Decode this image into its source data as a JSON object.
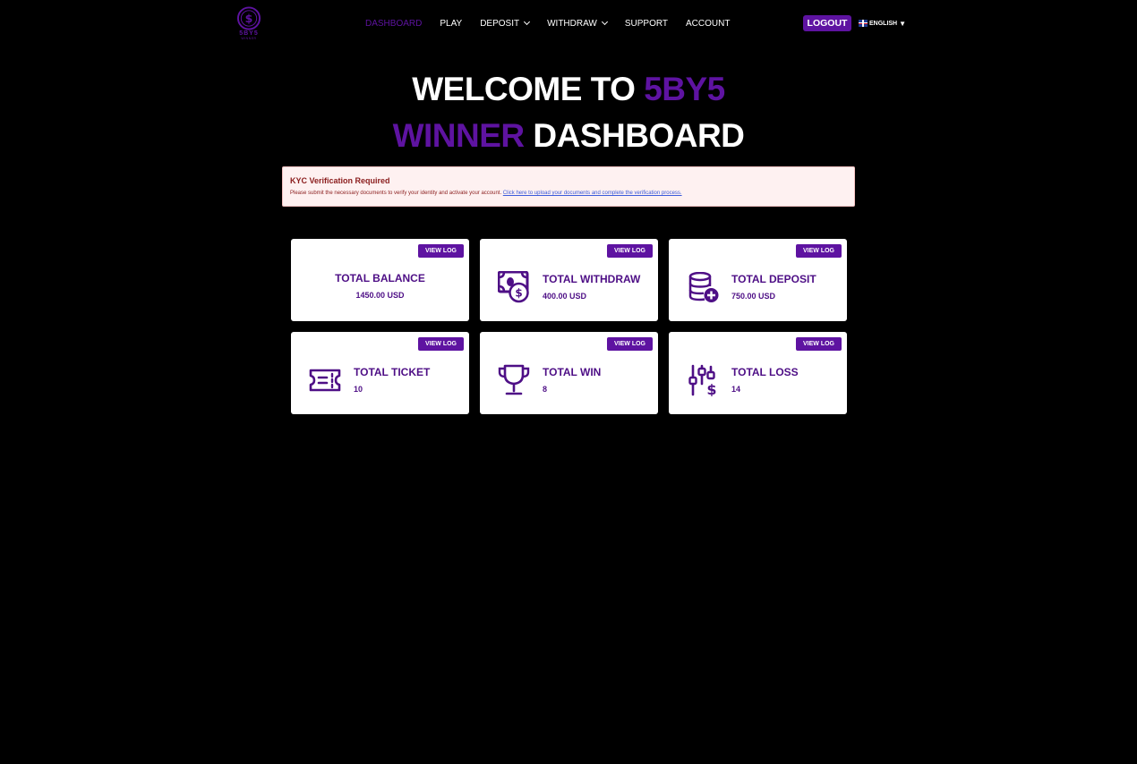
{
  "header": {
    "logo_text": "5BY5",
    "logo_subtext": "WINNER",
    "nav": [
      {
        "label": "DASHBOARD",
        "active": true,
        "dropdown": false
      },
      {
        "label": "PLAY",
        "active": false,
        "dropdown": false
      },
      {
        "label": "DEPOSIT",
        "active": false,
        "dropdown": true
      },
      {
        "label": "WITHDRAW",
        "active": false,
        "dropdown": true
      },
      {
        "label": "SUPPORT",
        "active": false,
        "dropdown": false
      },
      {
        "label": "ACCOUNT",
        "active": false,
        "dropdown": false
      }
    ],
    "logout_label": "LOGOUT",
    "language": {
      "label": "ENGLISH",
      "caret": "▼",
      "flag_icon": "uk-flag-icon"
    }
  },
  "headline": {
    "part1": "WELCOME TO ",
    "part2": "5BY5",
    "part3": "WINNER",
    "part4": " DASHBOARD"
  },
  "kyc_alert": {
    "title": "KYC Verification Required",
    "message": "Please submit the necessary documents to verify your identity and activate your account. ",
    "link_text": "Click here to upload your documents and complete the verification process."
  },
  "cards": [
    {
      "title": "TOTAL BALANCE",
      "value": "1450.00 USD",
      "button": "VIEW LOG",
      "icon": "none"
    },
    {
      "title": "TOTAL WITHDRAW",
      "value": "400.00 USD",
      "button": "VIEW LOG",
      "icon": "money-withdraw-icon"
    },
    {
      "title": "TOTAL DEPOSIT",
      "value": "750.00 USD",
      "button": "VIEW LOG",
      "icon": "coin-stack-plus-icon"
    },
    {
      "title": "TOTAL TICKET",
      "value": "10",
      "button": "VIEW LOG",
      "icon": "ticket-icon"
    },
    {
      "title": "TOTAL WIN",
      "value": "8",
      "button": "VIEW LOG",
      "icon": "trophy-icon"
    },
    {
      "title": "TOTAL LOSS",
      "value": "14",
      "button": "VIEW LOG",
      "icon": "sliders-dollar-icon"
    }
  ],
  "colors": {
    "background": "#000000",
    "brand_purple": "#5e13a1",
    "card_text": "#4e0f86",
    "alert_bg": "#fef1f1",
    "alert_text": "#8a1c1c",
    "link": "#3b5bdb"
  }
}
